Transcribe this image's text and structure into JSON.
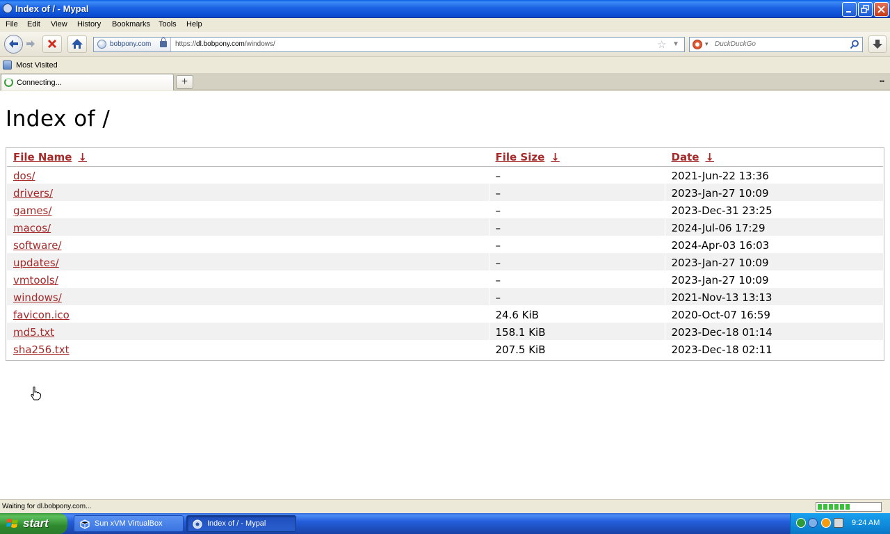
{
  "window": {
    "title": "Index of / - Mypal"
  },
  "menu": [
    "File",
    "Edit",
    "View",
    "History",
    "Bookmarks",
    "Tools",
    "Help"
  ],
  "urlbar": {
    "identity": "bobpony.com",
    "url_prefix": "https://",
    "url_domain": "dl.bobpony.com",
    "url_path": "/windows/"
  },
  "search": {
    "placeholder": "DuckDuckGo"
  },
  "bookmarks": {
    "most_visited": "Most Visited"
  },
  "tabs": [
    {
      "label": "Connecting..."
    }
  ],
  "page": {
    "heading": "Index of /",
    "columns": [
      {
        "label": "File Name",
        "sort": "↓"
      },
      {
        "label": "File Size",
        "sort": "↓"
      },
      {
        "label": "Date",
        "sort": "↓"
      }
    ],
    "rows": [
      {
        "name": "dos/",
        "size": "–",
        "date": "2021-Jun-22 13:36"
      },
      {
        "name": "drivers/",
        "size": "–",
        "date": "2023-Jan-27 10:09"
      },
      {
        "name": "games/",
        "size": "–",
        "date": "2023-Dec-31 23:25"
      },
      {
        "name": "macos/",
        "size": "–",
        "date": "2024-Jul-06 17:29"
      },
      {
        "name": "software/",
        "size": "–",
        "date": "2024-Apr-03 16:03"
      },
      {
        "name": "updates/",
        "size": "–",
        "date": "2023-Jan-27 10:09"
      },
      {
        "name": "vmtools/",
        "size": "–",
        "date": "2023-Jan-27 10:09"
      },
      {
        "name": "windows/",
        "size": "–",
        "date": "2021-Nov-13 13:13"
      },
      {
        "name": "favicon.ico",
        "size": "24.6 KiB",
        "date": "2020-Oct-07 16:59"
      },
      {
        "name": "md5.txt",
        "size": "158.1 KiB",
        "date": "2023-Dec-18 01:14"
      },
      {
        "name": "sha256.txt",
        "size": "207.5 KiB",
        "date": "2023-Dec-18 02:11"
      }
    ]
  },
  "status": {
    "text": "Waiting for dl.bobpony.com...",
    "progress": 0.5
  },
  "taskbar": {
    "start": "start",
    "tasks": [
      {
        "label": "Sun xVM VirtualBox",
        "active": false
      },
      {
        "label": "Index of / - Mypal",
        "active": true
      }
    ],
    "clock": "9:24 AM"
  },
  "colors": {
    "link": "#A52A2A",
    "titlebar": "#0A5FE5",
    "taskbar": "#245EDB",
    "start": "#3C9A3C",
    "progress": "#3CBF3C"
  }
}
